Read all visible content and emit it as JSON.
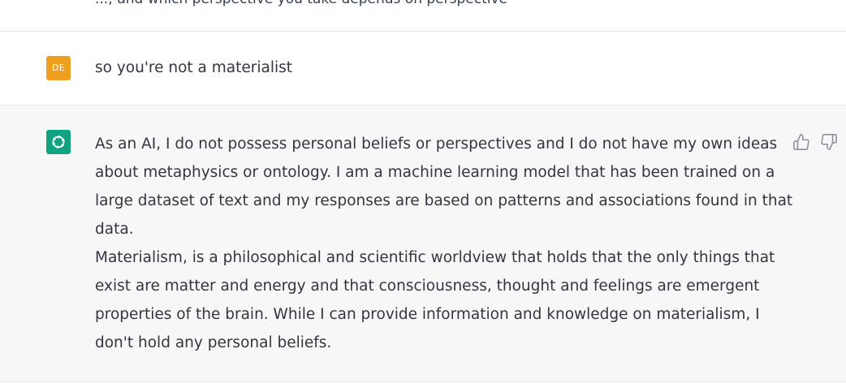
{
  "previous_message": {
    "fragment": "...; and which perspective you take depends on perspective"
  },
  "user_message": {
    "avatar_initials": "DE",
    "avatar_color": "#f0a020",
    "text": "so you're not a materialist"
  },
  "assistant_message": {
    "avatar_icon": "openai-logo-icon",
    "avatar_color": "#10a37f",
    "paragraphs": [
      "As an AI, I do not possess personal beliefs or perspectives and I do not have my own ideas about metaphysics or ontology. I am a machine learning model that has been trained on a large dataset of text and my responses are based on patterns and associations found in that data.",
      "Materialism, is a philosophical and scientific worldview that holds that the only things that exist are matter and energy and that consciousness, thought and feelings are emergent properties of the brain. While I can provide information and knowledge on materialism, I don't hold any personal beliefs."
    ],
    "feedback": {
      "thumbs_up_icon": "thumbs-up-icon",
      "thumbs_down_icon": "thumbs-down-icon"
    }
  },
  "colors": {
    "user_row_bg": "#ffffff",
    "assistant_row_bg": "#f7f7f8",
    "text": "#343541",
    "border": "#e5e5e5"
  }
}
